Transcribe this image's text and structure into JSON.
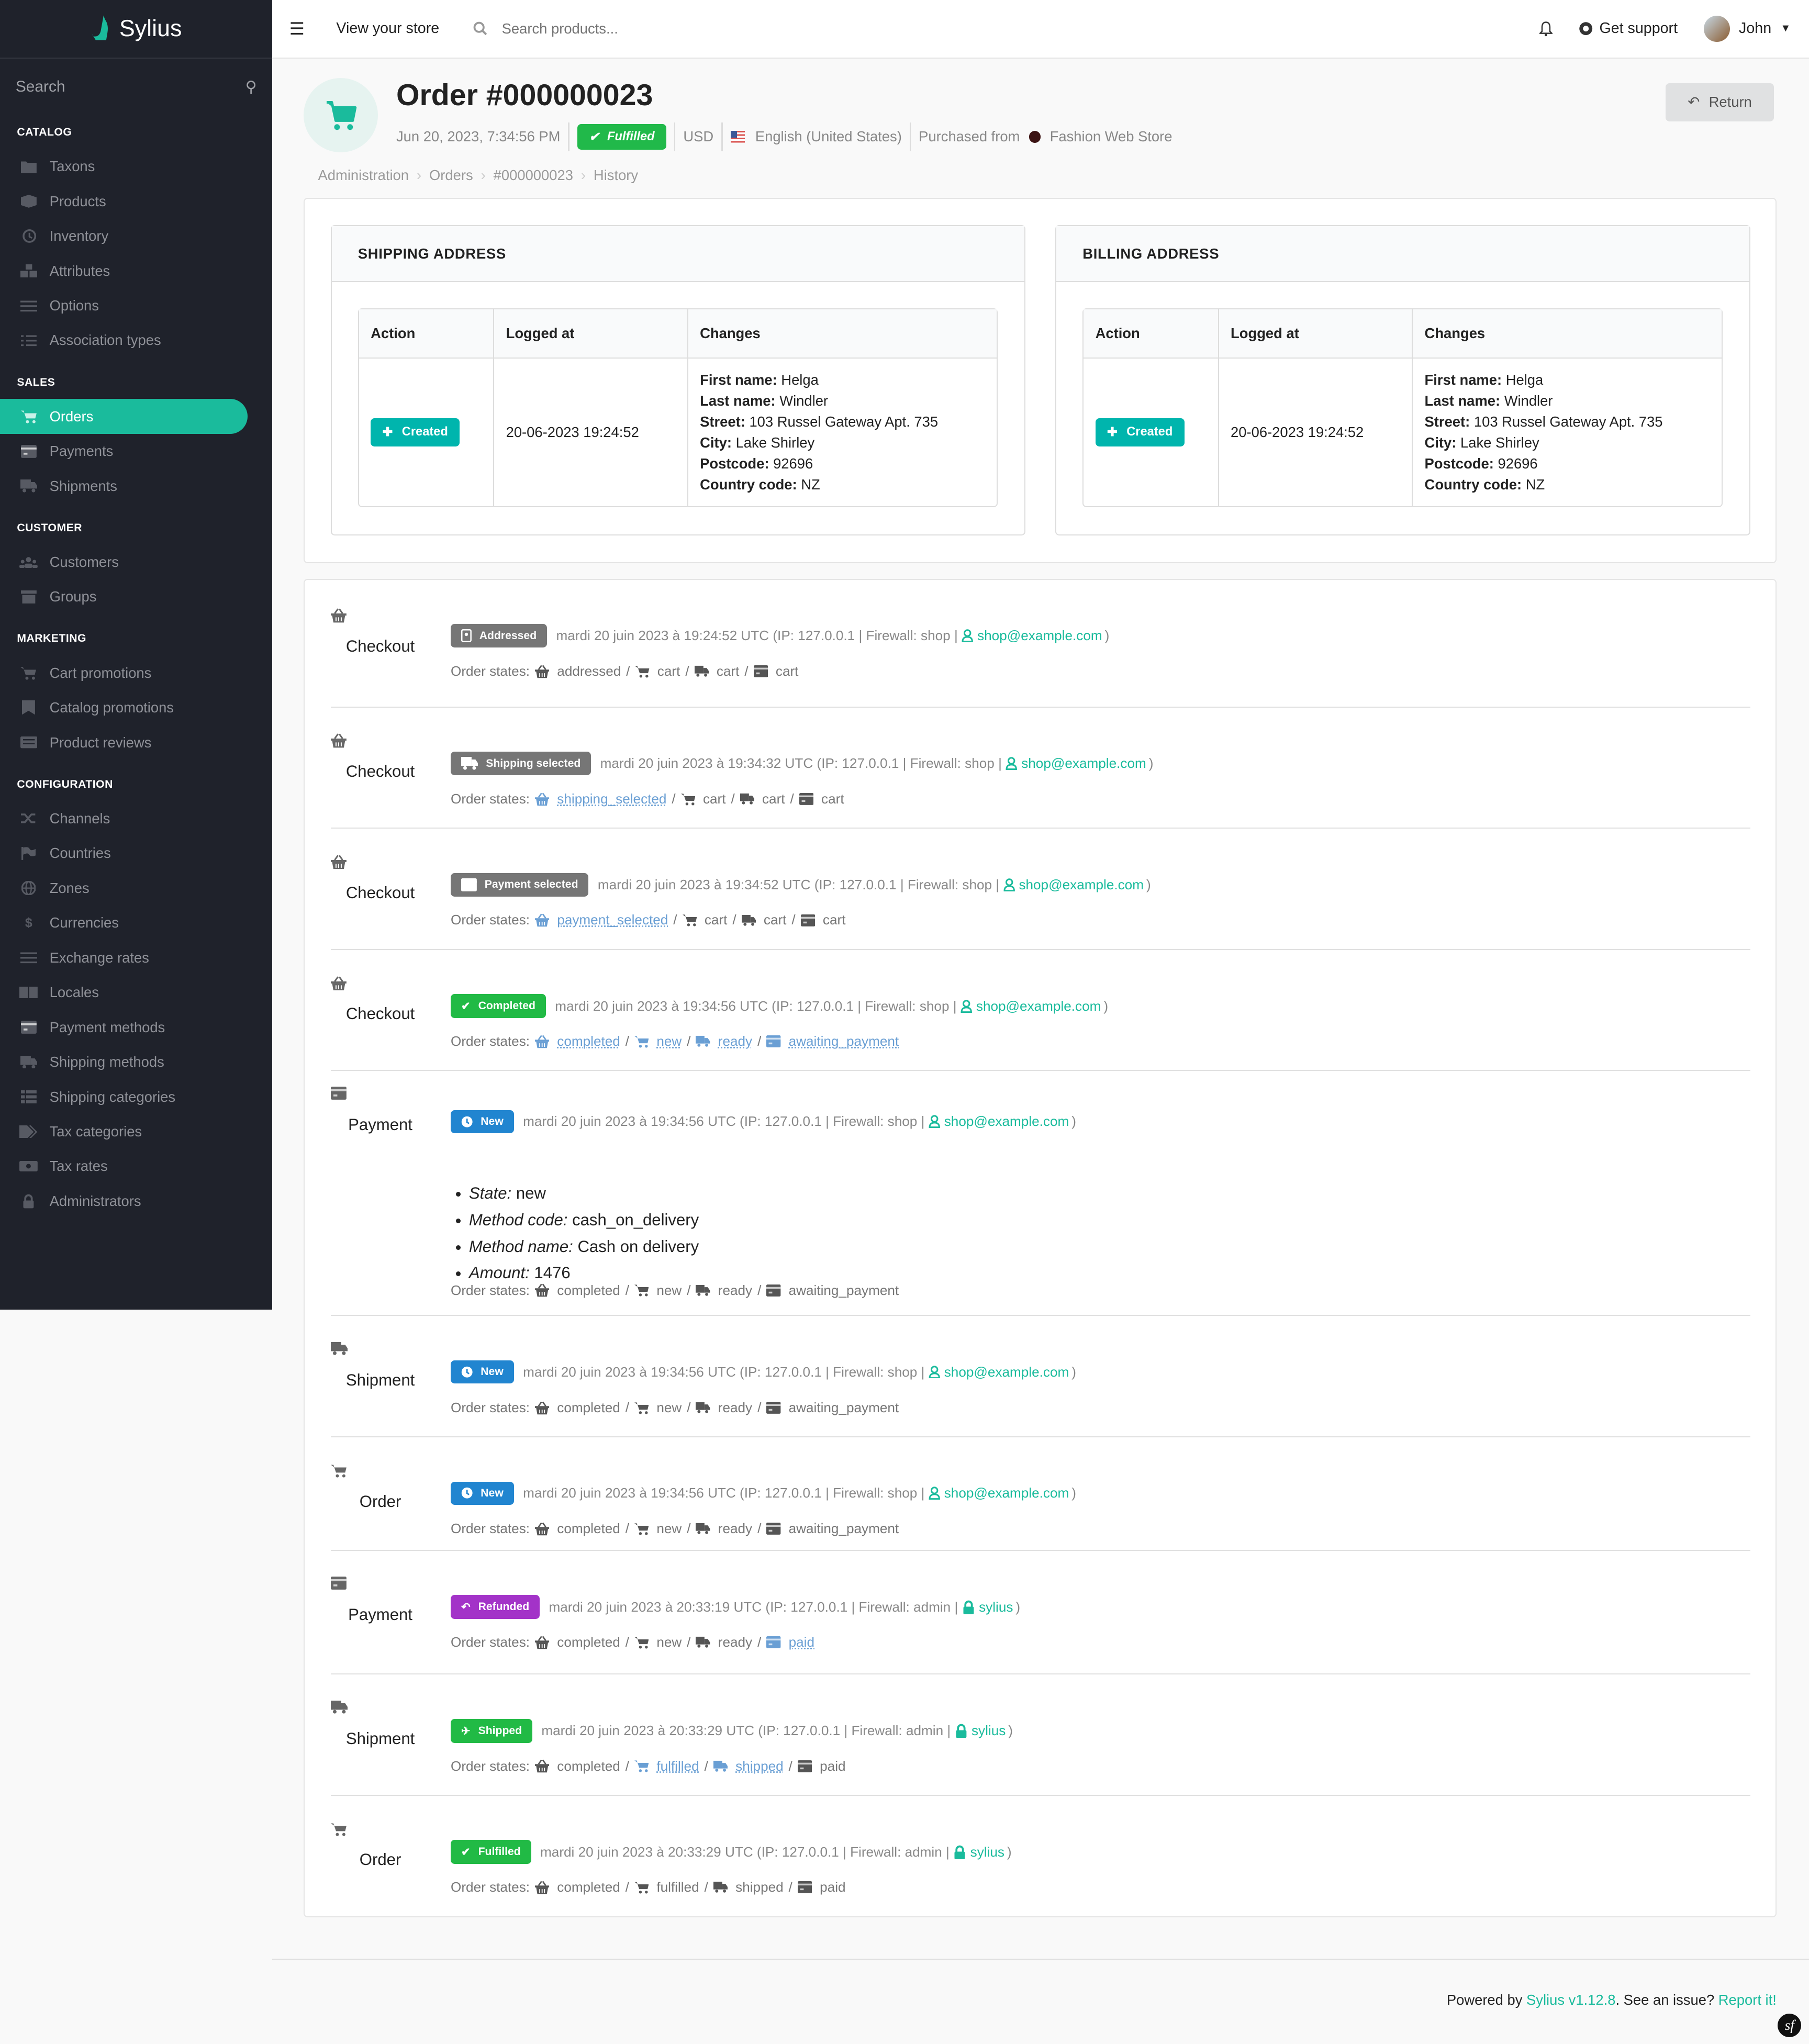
{
  "app": {
    "brand": "Sylius"
  },
  "sidebar": {
    "search_placeholder": "Search",
    "groups": [
      {
        "title": "CATALOG",
        "items": [
          {
            "label": "Taxons",
            "icon": "folder-icon"
          },
          {
            "label": "Products",
            "icon": "cube-icon"
          },
          {
            "label": "Inventory",
            "icon": "history-icon"
          },
          {
            "label": "Attributes",
            "icon": "cubes-icon"
          },
          {
            "label": "Options",
            "icon": "sliders-icon"
          },
          {
            "label": "Association types",
            "icon": "tasks-icon"
          }
        ]
      },
      {
        "title": "SALES",
        "items": [
          {
            "label": "Orders",
            "icon": "cart-icon",
            "active": true
          },
          {
            "label": "Payments",
            "icon": "credit-card-icon"
          },
          {
            "label": "Shipments",
            "icon": "truck-icon"
          }
        ]
      },
      {
        "title": "CUSTOMER",
        "items": [
          {
            "label": "Customers",
            "icon": "users-icon"
          },
          {
            "label": "Groups",
            "icon": "archive-icon"
          }
        ]
      },
      {
        "title": "MARKETING",
        "items": [
          {
            "label": "Cart promotions",
            "icon": "cart-plus-icon"
          },
          {
            "label": "Catalog promotions",
            "icon": "bookmark-icon"
          },
          {
            "label": "Product reviews",
            "icon": "newspaper-icon"
          }
        ]
      },
      {
        "title": "CONFIGURATION",
        "items": [
          {
            "label": "Channels",
            "icon": "random-icon"
          },
          {
            "label": "Countries",
            "icon": "flag-icon"
          },
          {
            "label": "Zones",
            "icon": "globe-icon"
          },
          {
            "label": "Currencies",
            "icon": "dollar-icon"
          },
          {
            "label": "Exchange rates",
            "icon": "sliders-icon"
          },
          {
            "label": "Locales",
            "icon": "language-icon"
          },
          {
            "label": "Payment methods",
            "icon": "credit-card-icon"
          },
          {
            "label": "Shipping methods",
            "icon": "truck-icon"
          },
          {
            "label": "Shipping categories",
            "icon": "list-icon"
          },
          {
            "label": "Tax categories",
            "icon": "tags-icon"
          },
          {
            "label": "Tax rates",
            "icon": "money-icon"
          },
          {
            "label": "Administrators",
            "icon": "lock-icon"
          }
        ]
      }
    ]
  },
  "topbar": {
    "view_store": "View your store",
    "search_placeholder": "Search products...",
    "get_support": "Get support",
    "user_name": "John"
  },
  "header": {
    "title": "Order #000000023",
    "date": "Jun 20, 2023, 7:34:56 PM",
    "status": "Fulfilled",
    "currency": "USD",
    "locale": "English (United States)",
    "purchased_from_label": "Purchased from",
    "channel": "Fashion Web Store",
    "channel_color": "#3c1414",
    "return_label": "Return"
  },
  "breadcrumb": [
    "Administration",
    "Orders",
    "#000000023",
    "History"
  ],
  "addresses": [
    {
      "title": "SHIPPING ADDRESS",
      "columns": [
        "Action",
        "Logged at",
        "Changes"
      ],
      "action": "Created",
      "logged_at": "20-06-2023 19:24:52",
      "changes": [
        {
          "key": "First name",
          "value": "Helga"
        },
        {
          "key": "Last name",
          "value": "Windler"
        },
        {
          "key": "Street",
          "value": "103 Russel Gateway Apt. 735"
        },
        {
          "key": "City",
          "value": "Lake Shirley"
        },
        {
          "key": "Postcode",
          "value": "92696"
        },
        {
          "key": "Country code",
          "value": "NZ"
        }
      ]
    },
    {
      "title": "BILLING ADDRESS",
      "columns": [
        "Action",
        "Logged at",
        "Changes"
      ],
      "action": "Created",
      "logged_at": "20-06-2023 19:24:52",
      "changes": [
        {
          "key": "First name",
          "value": "Helga"
        },
        {
          "key": "Last name",
          "value": "Windler"
        },
        {
          "key": "Street",
          "value": "103 Russel Gateway Apt. 735"
        },
        {
          "key": "City",
          "value": "Lake Shirley"
        },
        {
          "key": "Postcode",
          "value": "92696"
        },
        {
          "key": "Country code",
          "value": "NZ"
        }
      ]
    }
  ],
  "history": {
    "order_states_label": "Order states:",
    "entries": [
      {
        "type": "Checkout",
        "type_icon": "basket-icon",
        "label": "Addressed",
        "label_color": "grey",
        "label_icon": "address-card-icon",
        "timestamp": "mardi 20 juin 2023 à 19:24:52 UTC (IP: 127.0.0.1 | Firewall: shop |",
        "user": "shop@example.com",
        "user_icon": "user-icon",
        "states": [
          {
            "icon": "basket-icon",
            "value": "addressed"
          },
          {
            "icon": "cart-icon",
            "value": "cart"
          },
          {
            "icon": "truck-icon",
            "value": "cart"
          },
          {
            "icon": "credit-card-icon",
            "value": "cart"
          }
        ]
      },
      {
        "type": "Checkout",
        "type_icon": "basket-icon",
        "label": "Shipping selected",
        "label_color": "grey",
        "label_icon": "truck-icon",
        "timestamp": "mardi 20 juin 2023 à 19:34:32 UTC (IP: 127.0.0.1 | Firewall: shop |",
        "user": "shop@example.com",
        "user_icon": "user-icon",
        "states": [
          {
            "icon": "basket-icon",
            "value": "shipping_selected",
            "changed": true
          },
          {
            "icon": "cart-icon",
            "value": "cart"
          },
          {
            "icon": "truck-icon",
            "value": "cart"
          },
          {
            "icon": "credit-card-icon",
            "value": "cart"
          }
        ]
      },
      {
        "type": "Checkout",
        "type_icon": "basket-icon",
        "label": "Payment selected",
        "label_color": "grey",
        "label_icon": "credit-card-icon",
        "timestamp": "mardi 20 juin 2023 à 19:34:52 UTC (IP: 127.0.0.1 | Firewall: shop |",
        "user": "shop@example.com",
        "user_icon": "user-icon",
        "states": [
          {
            "icon": "basket-icon",
            "value": "payment_selected",
            "changed": true
          },
          {
            "icon": "cart-icon",
            "value": "cart"
          },
          {
            "icon": "truck-icon",
            "value": "cart"
          },
          {
            "icon": "credit-card-icon",
            "value": "cart"
          }
        ]
      },
      {
        "type": "Checkout",
        "type_icon": "basket-icon",
        "label": "Completed",
        "label_color": "green",
        "label_icon": "check-icon",
        "timestamp": "mardi 20 juin 2023 à 19:34:56 UTC (IP: 127.0.0.1 | Firewall: shop |",
        "user": "shop@example.com",
        "user_icon": "user-icon",
        "states": [
          {
            "icon": "basket-icon",
            "value": "completed",
            "changed": true
          },
          {
            "icon": "cart-icon",
            "value": "new",
            "changed": true
          },
          {
            "icon": "truck-icon",
            "value": "ready",
            "changed": true
          },
          {
            "icon": "credit-card-icon",
            "value": "awaiting_payment",
            "changed": true
          }
        ]
      },
      {
        "type": "Payment",
        "type_icon": "credit-card-icon",
        "label": "New",
        "label_color": "blue",
        "label_icon": "clock-icon",
        "timestamp": "mardi 20 juin 2023 à 19:34:56 UTC (IP: 127.0.0.1 | Firewall: shop |",
        "user": "shop@example.com",
        "user_icon": "user-icon",
        "details": [
          {
            "key": "State",
            "value": "new"
          },
          {
            "key": "Method code",
            "value": "cash_on_delivery"
          },
          {
            "key": "Method name",
            "value": "Cash on delivery"
          },
          {
            "key": "Amount",
            "value": "1476"
          }
        ],
        "states": [
          {
            "icon": "basket-icon",
            "value": "completed"
          },
          {
            "icon": "cart-icon",
            "value": "new"
          },
          {
            "icon": "truck-icon",
            "value": "ready"
          },
          {
            "icon": "credit-card-icon",
            "value": "awaiting_payment"
          }
        ]
      },
      {
        "type": "Shipment",
        "type_icon": "truck-icon",
        "label": "New",
        "label_color": "blue",
        "label_icon": "clock-icon",
        "timestamp": "mardi 20 juin 2023 à 19:34:56 UTC (IP: 127.0.0.1 | Firewall: shop |",
        "user": "shop@example.com",
        "user_icon": "user-icon",
        "states": [
          {
            "icon": "basket-icon",
            "value": "completed"
          },
          {
            "icon": "cart-icon",
            "value": "new"
          },
          {
            "icon": "truck-icon",
            "value": "ready"
          },
          {
            "icon": "credit-card-icon",
            "value": "awaiting_payment"
          }
        ]
      },
      {
        "type": "Order",
        "type_icon": "cart-icon",
        "label": "New",
        "label_color": "blue",
        "label_icon": "clock-icon",
        "timestamp": "mardi 20 juin 2023 à 19:34:56 UTC (IP: 127.0.0.1 | Firewall: shop |",
        "user": "shop@example.com",
        "user_icon": "user-icon",
        "states": [
          {
            "icon": "basket-icon",
            "value": "completed"
          },
          {
            "icon": "cart-icon",
            "value": "new"
          },
          {
            "icon": "truck-icon",
            "value": "ready"
          },
          {
            "icon": "credit-card-icon",
            "value": "awaiting_payment"
          }
        ]
      },
      {
        "type": "Payment",
        "type_icon": "credit-card-icon",
        "label": "Refunded",
        "label_color": "purple",
        "label_icon": "reply-icon",
        "timestamp": "mardi 20 juin 2023 à 20:33:19 UTC (IP: 127.0.0.1 | Firewall: admin |",
        "user": "sylius",
        "user_icon": "lock-icon",
        "states": [
          {
            "icon": "basket-icon",
            "value": "completed"
          },
          {
            "icon": "cart-icon",
            "value": "new"
          },
          {
            "icon": "truck-icon",
            "value": "ready"
          },
          {
            "icon": "credit-card-icon",
            "value": "paid",
            "changed": true
          }
        ]
      },
      {
        "type": "Shipment",
        "type_icon": "truck-icon",
        "label": "Shipped",
        "label_color": "green",
        "label_icon": "plane-icon",
        "timestamp": "mardi 20 juin 2023 à 20:33:29 UTC (IP: 127.0.0.1 | Firewall: admin |",
        "user": "sylius",
        "user_icon": "lock-icon",
        "states": [
          {
            "icon": "basket-icon",
            "value": "completed"
          },
          {
            "icon": "cart-icon",
            "value": "fulfilled",
            "changed": true
          },
          {
            "icon": "truck-icon",
            "value": "shipped",
            "changed": true
          },
          {
            "icon": "credit-card-icon",
            "value": "paid"
          }
        ]
      },
      {
        "type": "Order",
        "type_icon": "cart-icon",
        "label": "Fulfilled",
        "label_color": "green",
        "label_icon": "check-icon",
        "timestamp": "mardi 20 juin 2023 à 20:33:29 UTC (IP: 127.0.0.1 | Firewall: admin |",
        "user": "sylius",
        "user_icon": "lock-icon",
        "states": [
          {
            "icon": "basket-icon",
            "value": "completed"
          },
          {
            "icon": "cart-icon",
            "value": "fulfilled"
          },
          {
            "icon": "truck-icon",
            "value": "shipped"
          },
          {
            "icon": "credit-card-icon",
            "value": "paid"
          }
        ]
      }
    ]
  },
  "footer": {
    "powered_by": "Powered by ",
    "version_link": "Sylius v1.12.8",
    "issue_text": ". See an issue? ",
    "report_link": "Report it!"
  },
  "colors": {
    "accent": "#1abb9c",
    "sidebar_bg": "#1f222b",
    "changed_state": "#6a9fd4"
  }
}
